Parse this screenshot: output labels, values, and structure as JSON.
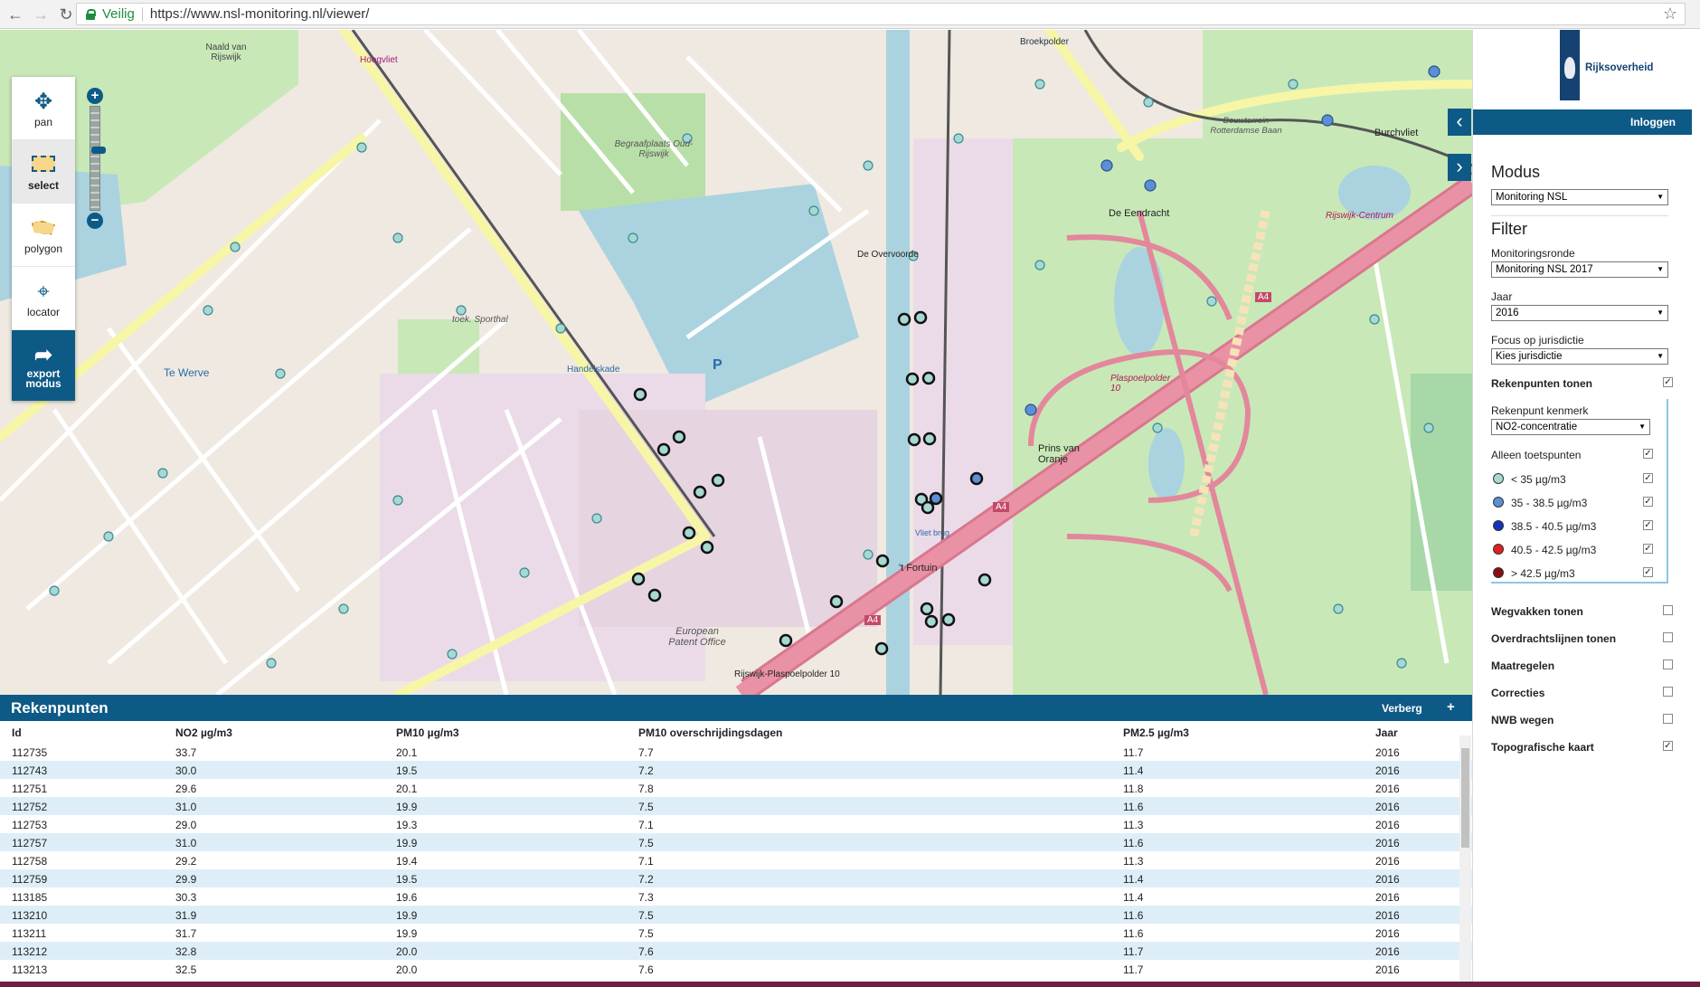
{
  "browser": {
    "secure_label": "Veilig",
    "url": "https://www.nsl-monitoring.nl/viewer/"
  },
  "tools": [
    {
      "label": "pan",
      "icon": "move-arrows-icon"
    },
    {
      "label": "select",
      "icon": "select-box-icon"
    },
    {
      "label": "polygon",
      "icon": "polygon-icon"
    },
    {
      "label": "locator",
      "icon": "crosshair-icon"
    },
    {
      "label": "export modus",
      "icon": "share-arrow-icon"
    }
  ],
  "map_labels": {
    "naald": "Naald van Rijswijk",
    "hoogvliet": "Hoogvliet",
    "begraafplaats": "Begraafplaats Oud-Rijswijk",
    "broekpolder": "Broekpolder",
    "bouwterrein": "Bouwterrein Rotterdamse Baan",
    "eendracht": "De Eendracht",
    "burchvliet": "Burchvliet",
    "overvoorde": "De Overvoorde",
    "te_werve": "Te Werve",
    "sporthal": "toek. Sporthal",
    "handelskade": "Handelskade",
    "plaspoelpolder": "Plaspoelpolder 10",
    "prins_van_oranje": "Prins van Oranje",
    "fortuin": "'t Fortuin",
    "viaduct": "Vliet brug",
    "european_patent_office": "European Patent Office",
    "rijswijk_plaspoelpolder": "Rijswijk-Plaspoelpolder 10",
    "rijswijk_centrum": "Rijswijk-Centrum",
    "a4": "A4",
    "p": "P"
  },
  "panel": {
    "org_name": "Rijksoverheid",
    "login_label": "Inloggen",
    "modus_heading": "Modus",
    "modus_value": "Monitoring NSL",
    "filter_heading": "Filter",
    "monitoringsronde_label": "Monitoringsronde",
    "monitoringsronde_value": "Monitoring NSL 2017",
    "jaar_label": "Jaar",
    "jaar_value": "2016",
    "jurisdictie_label": "Focus op jurisdictie",
    "jurisdictie_value": "Kies jurisdictie",
    "rekenpunten_tonen": "Rekenpunten tonen",
    "rekenpunt_kenmerk_label": "Rekenpunt kenmerk",
    "rekenpunt_kenmerk_value": "NO2-concentratie",
    "alleen_toetspunten": "Alleen toetspunten",
    "legend": [
      {
        "label": "< 35 µg/m3",
        "color": "#a6d8d4"
      },
      {
        "label": "35 - 38.5 µg/m3",
        "color": "#5b8fd6"
      },
      {
        "label": "38.5 - 40.5 µg/m3",
        "color": "#1531c4"
      },
      {
        "label": "40.5 - 42.5 µg/m3",
        "color": "#e02020"
      },
      {
        "label": "> 42.5 µg/m3",
        "color": "#8b0d0d"
      }
    ],
    "layers": [
      {
        "label": "Wegvakken tonen",
        "checked": false
      },
      {
        "label": "Overdrachtslijnen tonen",
        "checked": false
      },
      {
        "label": "Maatregelen",
        "checked": false
      },
      {
        "label": "Correcties",
        "checked": false
      },
      {
        "label": "NWB wegen",
        "checked": false
      },
      {
        "label": "Topografische kaart",
        "checked": true
      }
    ]
  },
  "table": {
    "title": "Rekenpunten",
    "hide_label": "Verberg",
    "add_label": "+",
    "columns": [
      "Id",
      "NO2 µg/m3",
      "PM10 µg/m3",
      "PM10 overschrijdingsdagen",
      "PM2.5 µg/m3",
      "Jaar"
    ],
    "rows": [
      [
        "112735",
        "33.7",
        "20.1",
        "7.7",
        "11.7",
        "2016"
      ],
      [
        "112743",
        "30.0",
        "19.5",
        "7.2",
        "11.4",
        "2016"
      ],
      [
        "112751",
        "29.6",
        "20.1",
        "7.8",
        "11.8",
        "2016"
      ],
      [
        "112752",
        "31.0",
        "19.9",
        "7.5",
        "11.6",
        "2016"
      ],
      [
        "112753",
        "29.0",
        "19.3",
        "7.1",
        "11.3",
        "2016"
      ],
      [
        "112757",
        "31.0",
        "19.9",
        "7.5",
        "11.6",
        "2016"
      ],
      [
        "112758",
        "29.2",
        "19.4",
        "7.1",
        "11.3",
        "2016"
      ],
      [
        "112759",
        "29.9",
        "19.5",
        "7.2",
        "11.4",
        "2016"
      ],
      [
        "113185",
        "30.3",
        "19.6",
        "7.3",
        "11.4",
        "2016"
      ],
      [
        "113210",
        "31.9",
        "19.9",
        "7.5",
        "11.6",
        "2016"
      ],
      [
        "113211",
        "31.7",
        "19.9",
        "7.5",
        "11.6",
        "2016"
      ],
      [
        "113212",
        "32.8",
        "20.0",
        "7.6",
        "11.7",
        "2016"
      ],
      [
        "113213",
        "32.5",
        "20.0",
        "7.6",
        "11.7",
        "2016"
      ]
    ]
  }
}
